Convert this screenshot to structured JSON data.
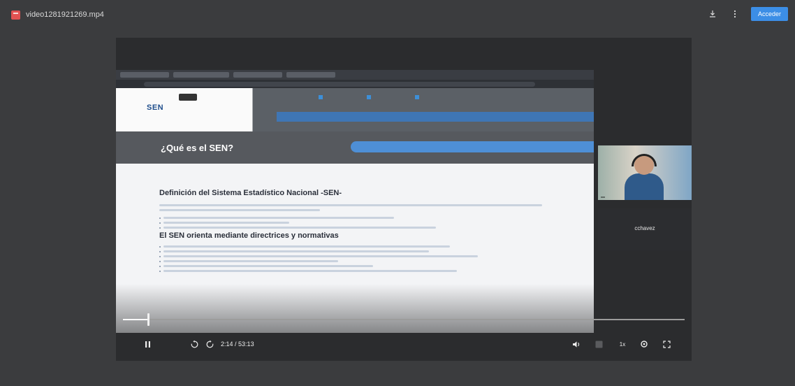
{
  "viewer": {
    "filename": "video1281921269.mp4",
    "open_button": "Acceder",
    "icons": {
      "download": "download-icon",
      "more": "more-vert-icon",
      "file": "video-file-icon"
    }
  },
  "shared_screen": {
    "page_heading": "¿Qué es el SEN?",
    "section_title_1": "Definición del Sistema Estadístico Nacional -SEN-",
    "section_title_2": "El SEN orienta mediante directrices y normativas"
  },
  "participant": {
    "speaker_label": "cchavez"
  },
  "player": {
    "time_current": "2:14",
    "time_separator": " / ",
    "time_total": "53:13",
    "speed": "1x",
    "progress": 0.045,
    "icons": {
      "pause": "pause-icon",
      "rewind": "rewind-10-icon",
      "forward": "forward-10-icon",
      "volume": "volume-icon",
      "captions": "captions-icon",
      "settings": "settings-gear-icon",
      "fullscreen": "fullscreen-icon"
    }
  }
}
